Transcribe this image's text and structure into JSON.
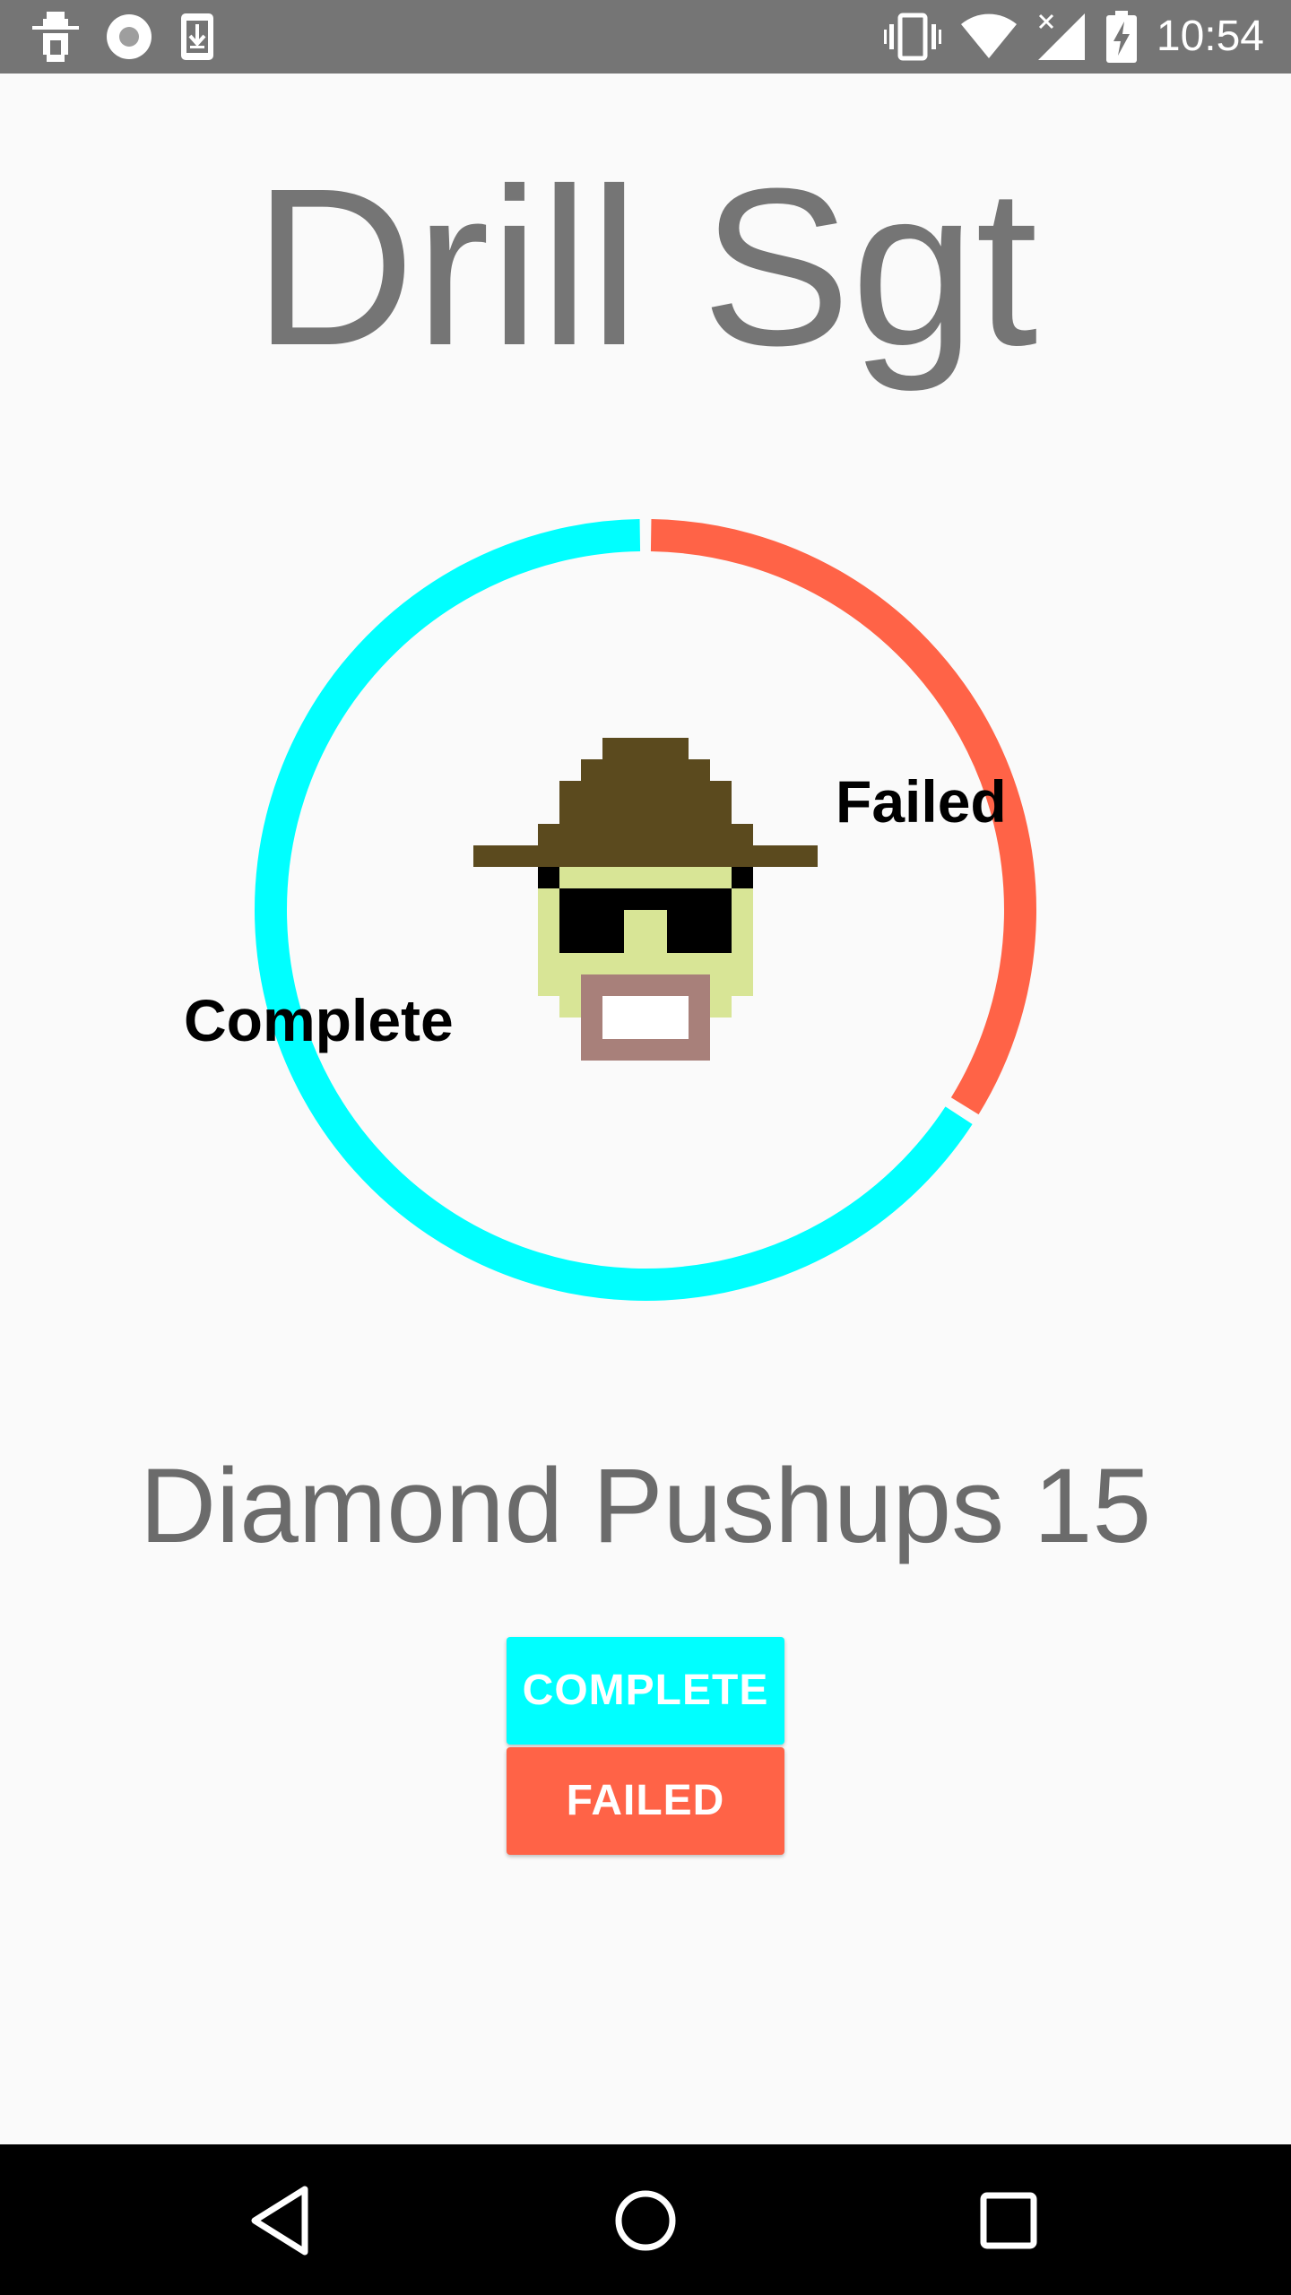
{
  "status_bar": {
    "time": "10:54",
    "left_icons": [
      "drill-sgt-notification-icon",
      "radio-record-icon",
      "download-icon"
    ],
    "right_icons": [
      "vibrate-icon",
      "wifi-icon",
      "cell-signal-icon",
      "battery-charging-icon"
    ]
  },
  "app": {
    "title": "Drill Sgt"
  },
  "chart_data": {
    "type": "pie",
    "style": "donut",
    "series": [
      {
        "name": "Failed",
        "value": 34,
        "color": "#ff6347"
      },
      {
        "name": "Complete",
        "value": 66,
        "color": "#00ffff"
      }
    ],
    "start_angle_deg": 0,
    "direction": "clockwise",
    "center_icon": "drill-sergeant-pixel-face-icon"
  },
  "exercise": {
    "label": "Diamond Pushups 15"
  },
  "buttons": {
    "complete_label": "COMPLETE",
    "failed_label": "FAILED"
  },
  "nav_bar": {
    "icons": [
      "back-icon",
      "home-icon",
      "recents-icon"
    ]
  }
}
